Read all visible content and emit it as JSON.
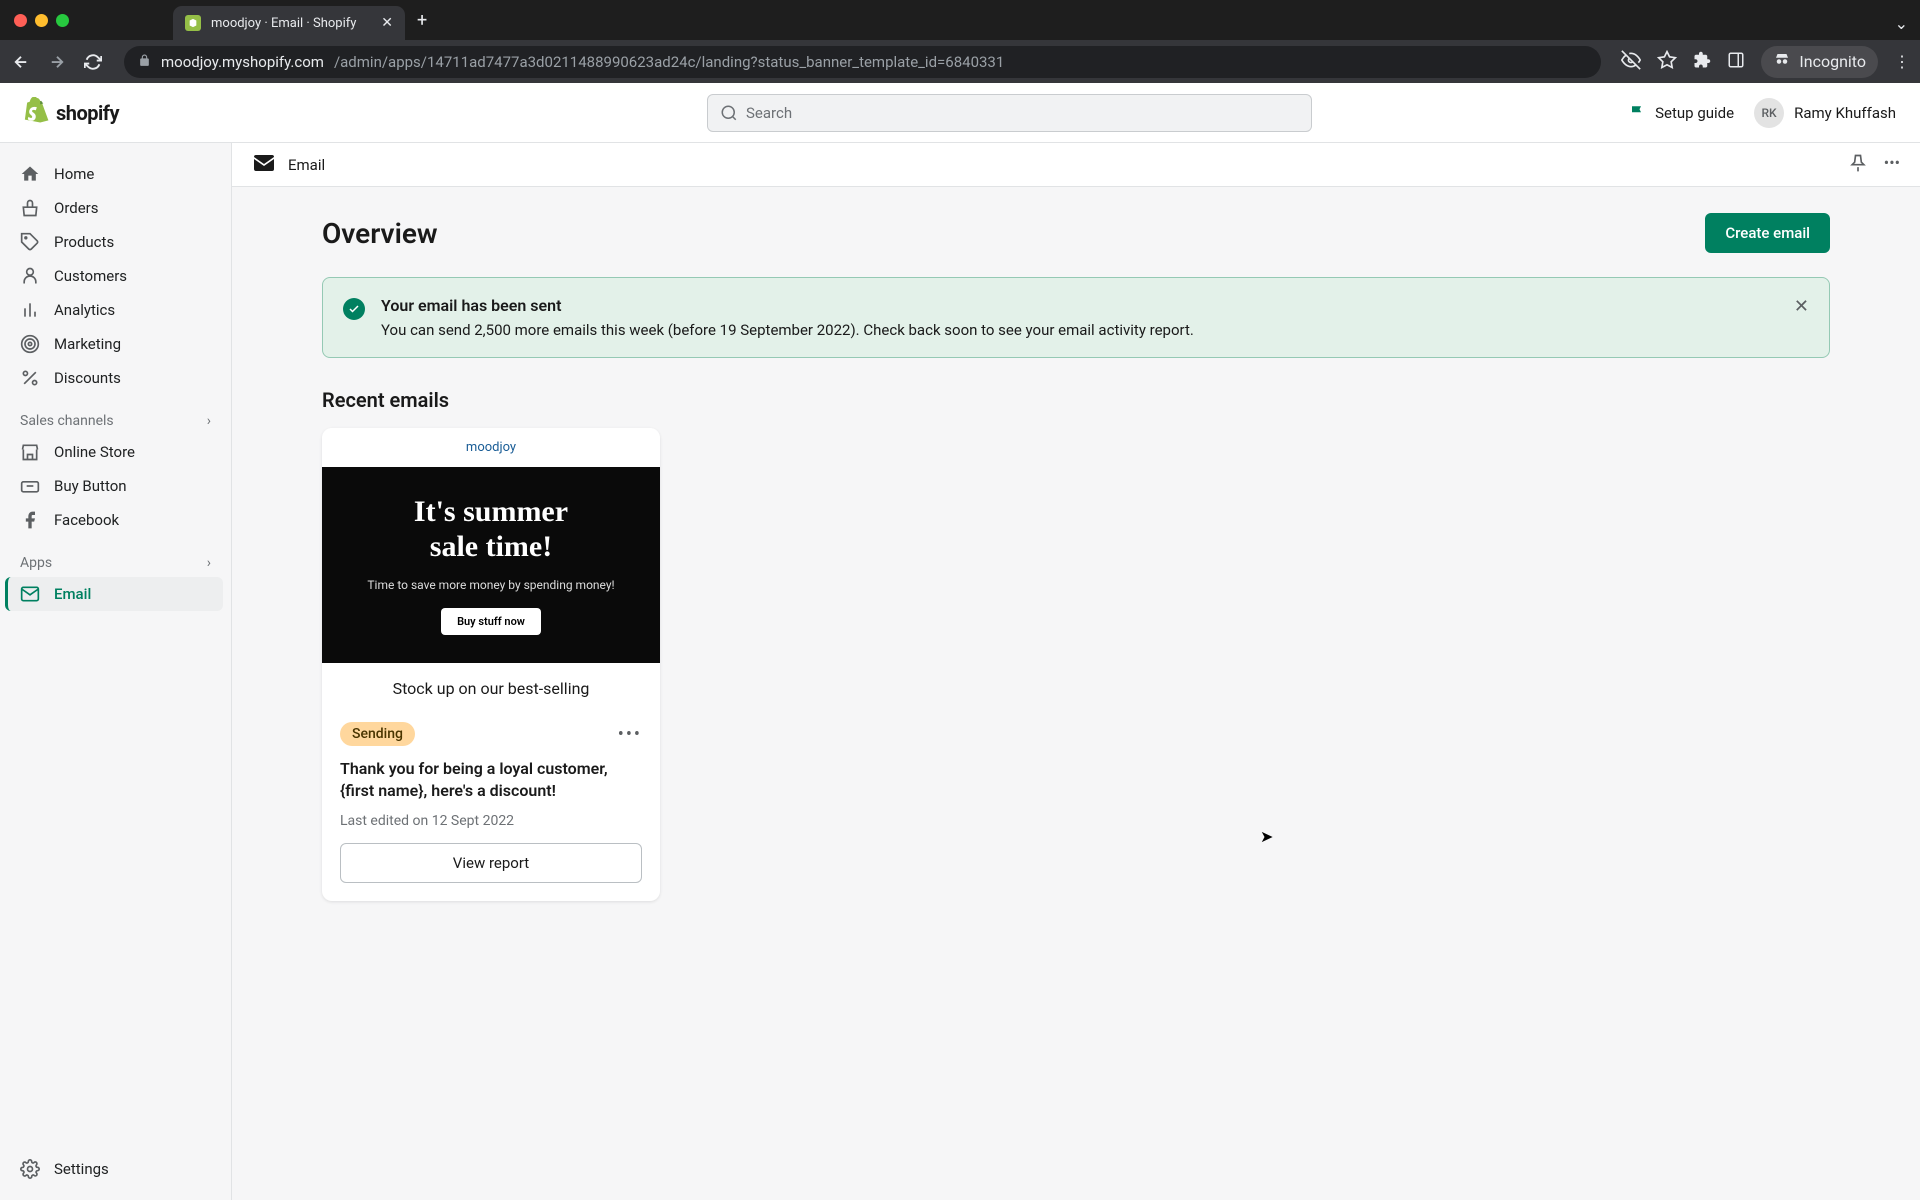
{
  "browser": {
    "tab_title": "moodjoy · Email · Shopify",
    "url_host": "moodjoy.myshopify.com",
    "url_path": "/admin/apps/14711ad7477a3d0211488990623ad24c/landing?status_banner_template_id=6840331",
    "incognito_label": "Incognito"
  },
  "topbar": {
    "search_placeholder": "Search",
    "setup_guide": "Setup guide",
    "user_initials": "RK",
    "user_name": "Ramy Khuffash"
  },
  "sidebar": {
    "items": [
      "Home",
      "Orders",
      "Products",
      "Customers",
      "Analytics",
      "Marketing",
      "Discounts"
    ],
    "section_channels": "Sales channels",
    "channels": [
      "Online Store",
      "Buy Button",
      "Facebook"
    ],
    "section_apps": "Apps",
    "apps": [
      "Email"
    ],
    "settings": "Settings"
  },
  "app_header": {
    "title": "Email"
  },
  "page": {
    "title": "Overview",
    "create_button": "Create email"
  },
  "banner": {
    "title": "Your email has been sent",
    "body": "You can send 2,500 more emails this week (before 19 September 2022). Check back soon to see your email activity report."
  },
  "recent": {
    "heading": "Recent emails",
    "card": {
      "brand": "moodjoy",
      "hero_line1": "It's summer",
      "hero_line2": "sale time!",
      "hero_sub": "Time to save more money by spending money!",
      "hero_cta": "Buy stuff now",
      "preview_footer": "Stock up on our best-selling",
      "status": "Sending",
      "title": "Thank you for being a loyal customer, {first name}, here's a discount!",
      "edited": "Last edited on 12 Sept 2022",
      "view_report": "View report"
    }
  }
}
